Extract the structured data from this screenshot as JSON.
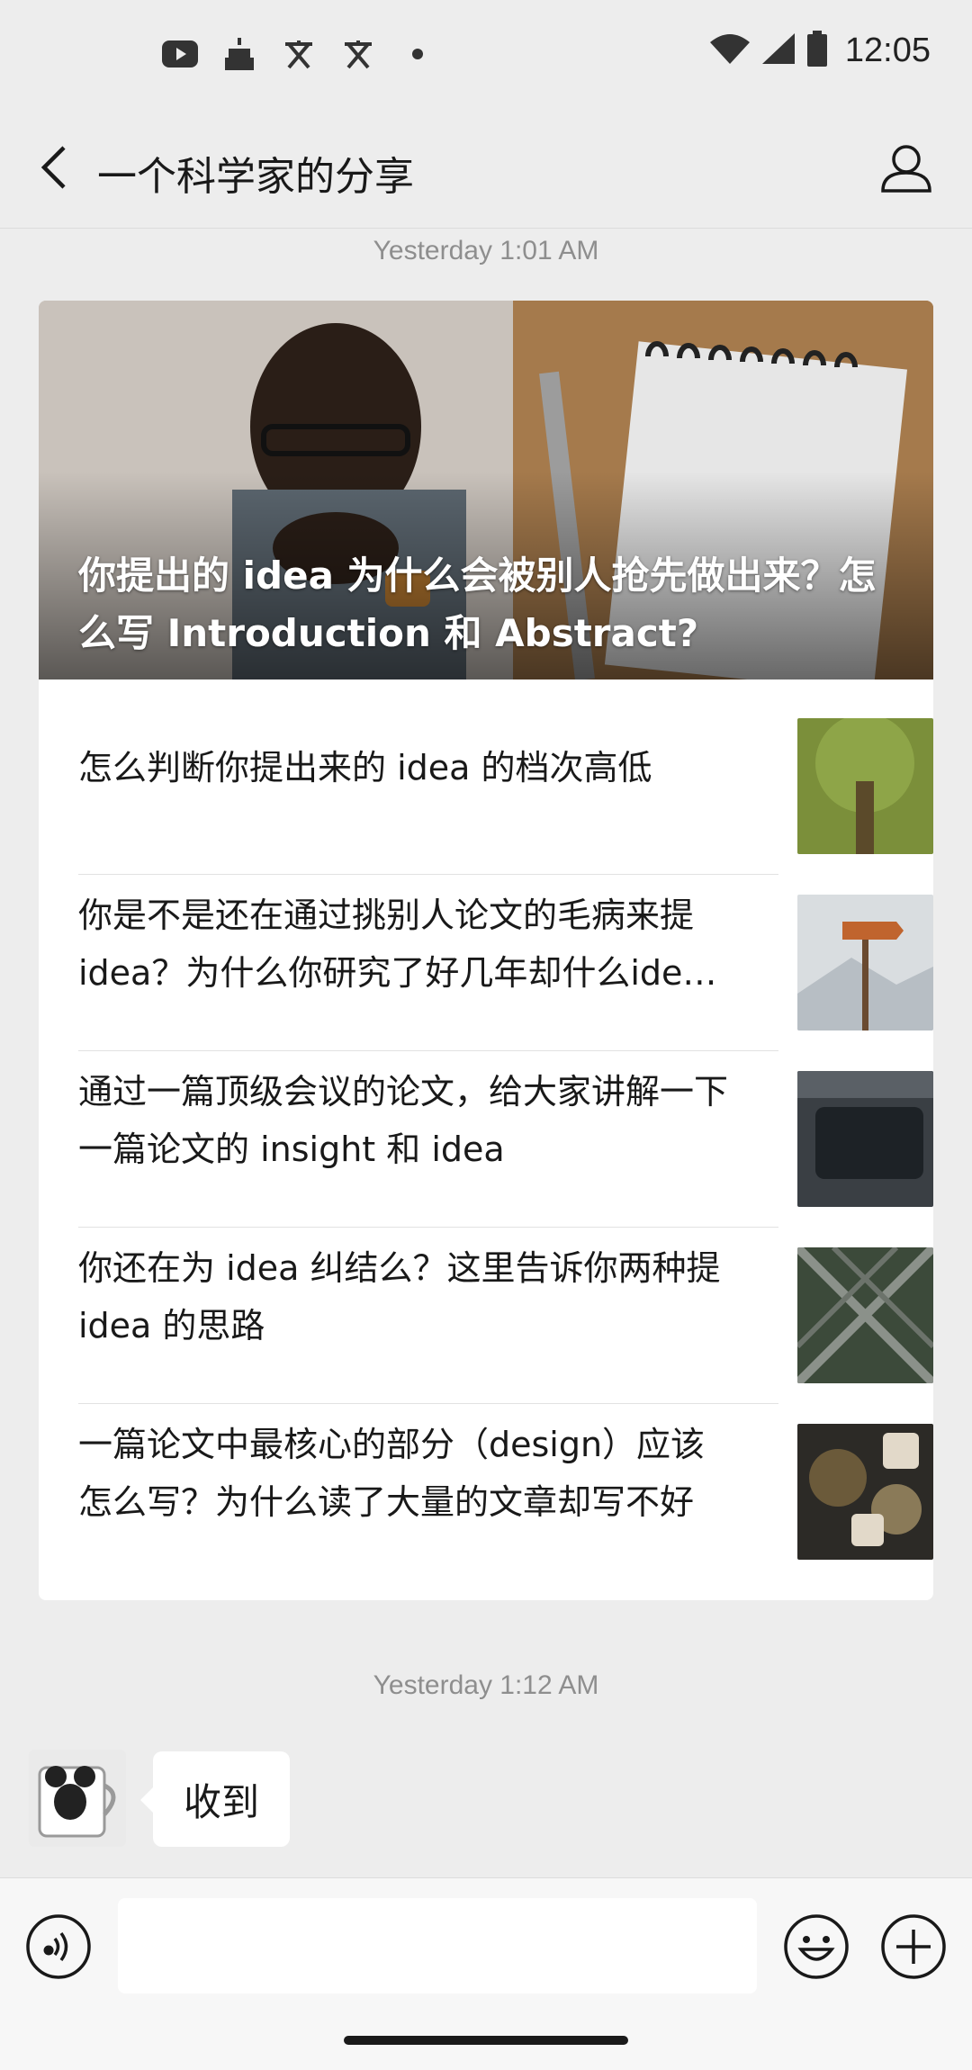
{
  "status_bar": {
    "time": "12:05",
    "left_icons": [
      "youtube-icon",
      "cake-icon",
      "translate-icon",
      "translate-icon",
      "dot-icon"
    ],
    "right_icons": [
      "wifi-icon",
      "cell-signal-icon",
      "battery-icon"
    ]
  },
  "header": {
    "title": "一个科学家的分享",
    "back_icon": "chevron-left-icon",
    "profile_icon": "person-icon"
  },
  "messages": {
    "timestamp_1": "Yesterday 1:01 AM",
    "timestamp_2": "Yesterday 1:12 AM"
  },
  "article_card": {
    "hero_title": "你提出的 idea 为什么会被别人抢先做出来？怎么写 Introduction 和 Abstract?",
    "items": [
      {
        "title": "怎么判断你提出来的 idea 的档次高低"
      },
      {
        "title": "你是不是还在通过挑别人论文的毛病来提 idea？为什么你研究了好几年却什么idea也没提出来"
      },
      {
        "title": "通过一篇顶级会议的论文，给大家讲解一下一篇论文的 insight 和 idea"
      },
      {
        "title": "你还在为 idea 纠结么？这里告诉你两种提 idea 的思路"
      },
      {
        "title": "一篇论文中最核心的部分（design）应该怎么写？为什么读了大量的文章却写不好"
      }
    ]
  },
  "reply": {
    "text": "收到"
  },
  "input_bar": {
    "voice_icon": "voice-icon",
    "emoji_icon": "emoji-icon",
    "plus_icon": "plus-icon",
    "input_value": ""
  },
  "colors": {
    "background": "#ededed",
    "card": "#ffffff",
    "timestamp": "#8e8e8e",
    "text": "#191919"
  }
}
